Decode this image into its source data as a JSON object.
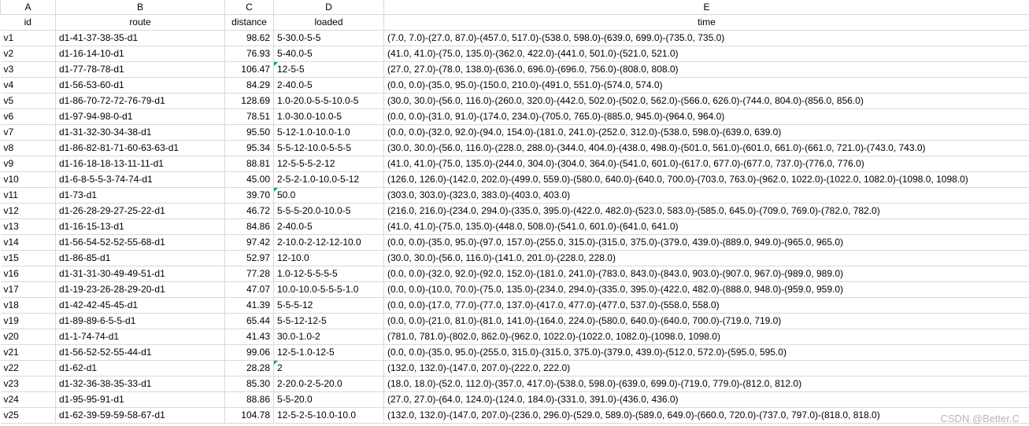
{
  "columns": {
    "A": "A",
    "B": "B",
    "C": "C",
    "D": "D",
    "E": "E"
  },
  "headers": {
    "id": "id",
    "route": "route",
    "distance": "distance",
    "loaded": "loaded",
    "time": "time"
  },
  "watermark": "CSDN @Better.C",
  "rows": [
    {
      "id": "v1",
      "route": "d1-41-37-38-35-d1",
      "distance": "98.62",
      "loaded": "5-30.0-5-5",
      "time": "(7.0, 7.0)-(27.0, 87.0)-(457.0, 517.0)-(538.0, 598.0)-(639.0, 699.0)-(735.0, 735.0)",
      "tri": false
    },
    {
      "id": "v2",
      "route": "d1-16-14-10-d1",
      "distance": "76.93",
      "loaded": "5-40.0-5",
      "time": "(41.0, 41.0)-(75.0, 135.0)-(362.0, 422.0)-(441.0, 501.0)-(521.0, 521.0)",
      "tri": false
    },
    {
      "id": "v3",
      "route": "d1-77-78-78-d1",
      "distance": "106.47",
      "loaded": "12-5-5",
      "time": "(27.0, 27.0)-(78.0, 138.0)-(636.0, 696.0)-(696.0, 756.0)-(808.0, 808.0)",
      "tri": true
    },
    {
      "id": "v4",
      "route": "d1-56-53-60-d1",
      "distance": "84.29",
      "loaded": "2-40.0-5",
      "time": "(0.0, 0.0)-(35.0, 95.0)-(150.0, 210.0)-(491.0, 551.0)-(574.0, 574.0)",
      "tri": false
    },
    {
      "id": "v5",
      "route": "d1-86-70-72-72-76-79-d1",
      "distance": "128.69",
      "loaded": "1.0-20.0-5-5-10.0-5",
      "time": "(30.0, 30.0)-(56.0, 116.0)-(260.0, 320.0)-(442.0, 502.0)-(502.0, 562.0)-(566.0, 626.0)-(744.0, 804.0)-(856.0, 856.0)",
      "tri": false
    },
    {
      "id": "v6",
      "route": "d1-97-94-98-0-d1",
      "distance": "78.51",
      "loaded": "1.0-30.0-10.0-5",
      "time": "(0.0, 0.0)-(31.0, 91.0)-(174.0, 234.0)-(705.0, 765.0)-(885.0, 945.0)-(964.0, 964.0)",
      "tri": false
    },
    {
      "id": "v7",
      "route": "d1-31-32-30-34-38-d1",
      "distance": "95.50",
      "loaded": "5-12-1.0-10.0-1.0",
      "time": "(0.0, 0.0)-(32.0, 92.0)-(94.0, 154.0)-(181.0, 241.0)-(252.0, 312.0)-(538.0, 598.0)-(639.0, 639.0)",
      "tri": false
    },
    {
      "id": "v8",
      "route": "d1-86-82-81-71-60-63-63-d1",
      "distance": "95.34",
      "loaded": "5-5-12-10.0-5-5-5",
      "time": "(30.0, 30.0)-(56.0, 116.0)-(228.0, 288.0)-(344.0, 404.0)-(438.0, 498.0)-(501.0, 561.0)-(601.0, 661.0)-(661.0, 721.0)-(743.0, 743.0)",
      "tri": false
    },
    {
      "id": "v9",
      "route": "d1-16-18-18-13-11-11-d1",
      "distance": "88.81",
      "loaded": "12-5-5-5-2-12",
      "time": "(41.0, 41.0)-(75.0, 135.0)-(244.0, 304.0)-(304.0, 364.0)-(541.0, 601.0)-(617.0, 677.0)-(677.0, 737.0)-(776.0, 776.0)",
      "tri": false
    },
    {
      "id": "v10",
      "route": "d1-6-8-5-5-3-74-74-d1",
      "distance": "45.00",
      "loaded": "2-5-2-1.0-10.0-5-12",
      "time": "(126.0, 126.0)-(142.0, 202.0)-(499.0, 559.0)-(580.0, 640.0)-(640.0, 700.0)-(703.0, 763.0)-(962.0, 1022.0)-(1022.0, 1082.0)-(1098.0, 1098.0)",
      "tri": false
    },
    {
      "id": "v11",
      "route": "d1-73-d1",
      "distance": "39.70",
      "loaded": "50.0",
      "time": "(303.0, 303.0)-(323.0, 383.0)-(403.0, 403.0)",
      "tri": true
    },
    {
      "id": "v12",
      "route": "d1-26-28-29-27-25-22-d1",
      "distance": "46.72",
      "loaded": "5-5-5-20.0-10.0-5",
      "time": "(216.0, 216.0)-(234.0, 294.0)-(335.0, 395.0)-(422.0, 482.0)-(523.0, 583.0)-(585.0, 645.0)-(709.0, 769.0)-(782.0, 782.0)",
      "tri": false
    },
    {
      "id": "v13",
      "route": "d1-16-15-13-d1",
      "distance": "84.86",
      "loaded": "2-40.0-5",
      "time": "(41.0, 41.0)-(75.0, 135.0)-(448.0, 508.0)-(541.0, 601.0)-(641.0, 641.0)",
      "tri": false
    },
    {
      "id": "v14",
      "route": "d1-56-54-52-52-55-68-d1",
      "distance": "97.42",
      "loaded": "2-10.0-2-12-12-10.0",
      "time": "(0.0, 0.0)-(35.0, 95.0)-(97.0, 157.0)-(255.0, 315.0)-(315.0, 375.0)-(379.0, 439.0)-(889.0, 949.0)-(965.0, 965.0)",
      "tri": false
    },
    {
      "id": "v15",
      "route": "d1-86-85-d1",
      "distance": "52.97",
      "loaded": "12-10.0",
      "time": "(30.0, 30.0)-(56.0, 116.0)-(141.0, 201.0)-(228.0, 228.0)",
      "tri": false
    },
    {
      "id": "v16",
      "route": "d1-31-31-30-49-49-51-d1",
      "distance": "77.28",
      "loaded": "1.0-12-5-5-5-5",
      "time": "(0.0, 0.0)-(32.0, 92.0)-(92.0, 152.0)-(181.0, 241.0)-(783.0, 843.0)-(843.0, 903.0)-(907.0, 967.0)-(989.0, 989.0)",
      "tri": false
    },
    {
      "id": "v17",
      "route": "d1-19-23-26-28-29-20-d1",
      "distance": "47.07",
      "loaded": "10.0-10.0-5-5-5-1.0",
      "time": "(0.0, 0.0)-(10.0, 70.0)-(75.0, 135.0)-(234.0, 294.0)-(335.0, 395.0)-(422.0, 482.0)-(888.0, 948.0)-(959.0, 959.0)",
      "tri": false
    },
    {
      "id": "v18",
      "route": "d1-42-42-45-45-d1",
      "distance": "41.39",
      "loaded": "5-5-5-12",
      "time": "(0.0, 0.0)-(17.0, 77.0)-(77.0, 137.0)-(417.0, 477.0)-(477.0, 537.0)-(558.0, 558.0)",
      "tri": false
    },
    {
      "id": "v19",
      "route": "d1-89-89-6-5-5-d1",
      "distance": "65.44",
      "loaded": "5-5-12-12-5",
      "time": "(0.0, 0.0)-(21.0, 81.0)-(81.0, 141.0)-(164.0, 224.0)-(580.0, 640.0)-(640.0, 700.0)-(719.0, 719.0)",
      "tri": false
    },
    {
      "id": "v20",
      "route": "d1-1-74-74-d1",
      "distance": "41.43",
      "loaded": "30.0-1.0-2",
      "time": "(781.0, 781.0)-(802.0, 862.0)-(962.0, 1022.0)-(1022.0, 1082.0)-(1098.0, 1098.0)",
      "tri": false
    },
    {
      "id": "v21",
      "route": "d1-56-52-52-55-44-d1",
      "distance": "99.06",
      "loaded": "12-5-1.0-12-5",
      "time": "(0.0, 0.0)-(35.0, 95.0)-(255.0, 315.0)-(315.0, 375.0)-(379.0, 439.0)-(512.0, 572.0)-(595.0, 595.0)",
      "tri": false
    },
    {
      "id": "v22",
      "route": "d1-62-d1",
      "distance": "28.28",
      "loaded": "2",
      "time": "(132.0, 132.0)-(147.0, 207.0)-(222.0, 222.0)",
      "tri": true
    },
    {
      "id": "v23",
      "route": "d1-32-36-38-35-33-d1",
      "distance": "85.30",
      "loaded": "2-20.0-2-5-20.0",
      "time": "(18.0, 18.0)-(52.0, 112.0)-(357.0, 417.0)-(538.0, 598.0)-(639.0, 699.0)-(719.0, 779.0)-(812.0, 812.0)",
      "tri": false
    },
    {
      "id": "v24",
      "route": "d1-95-95-91-d1",
      "distance": "88.86",
      "loaded": "5-5-20.0",
      "time": "(27.0, 27.0)-(64.0, 124.0)-(124.0, 184.0)-(331.0, 391.0)-(436.0, 436.0)",
      "tri": false
    },
    {
      "id": "v25",
      "route": "d1-62-39-59-59-58-67-d1",
      "distance": "104.78",
      "loaded": "12-5-2-5-10.0-10.0",
      "time": "(132.0, 132.0)-(147.0, 207.0)-(236.0, 296.0)-(529.0, 589.0)-(589.0, 649.0)-(660.0, 720.0)-(737.0, 797.0)-(818.0, 818.0)",
      "tri": false
    }
  ]
}
